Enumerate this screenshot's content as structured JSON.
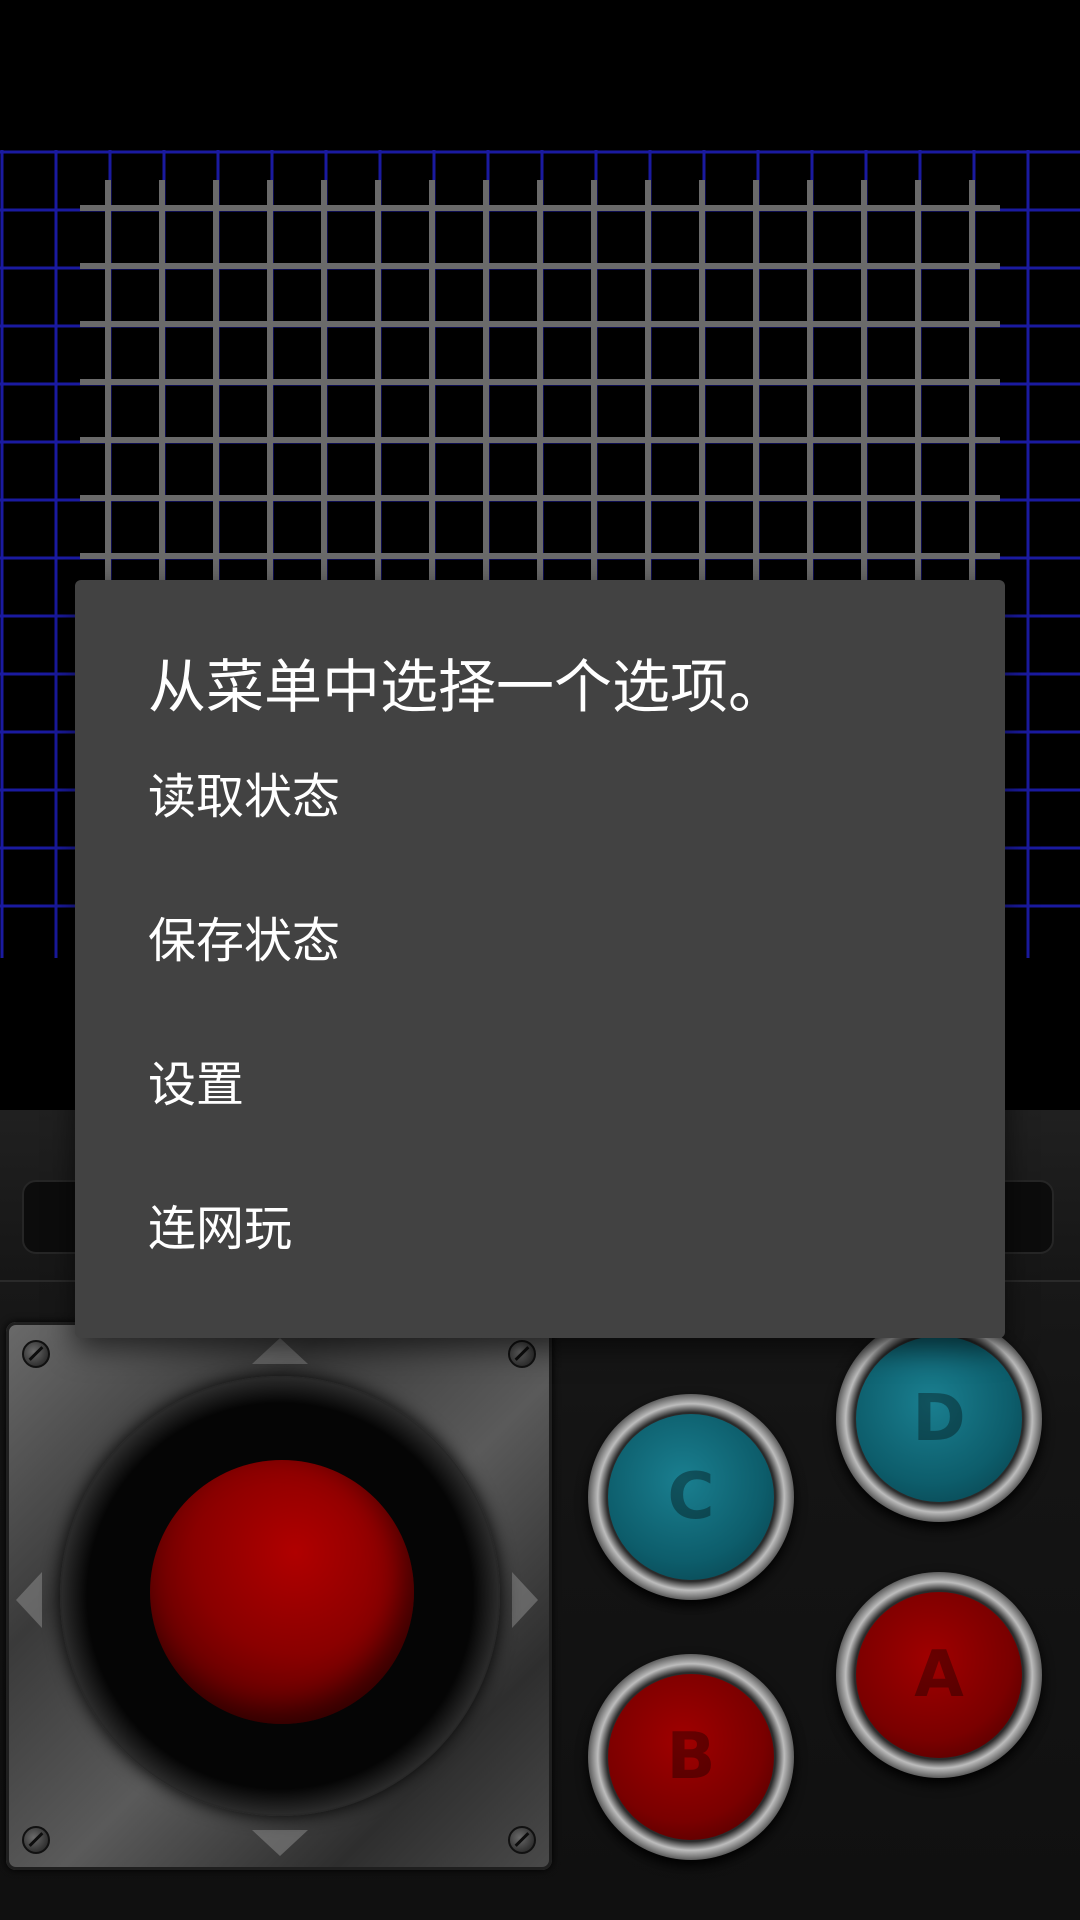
{
  "dialog": {
    "title": "从菜单中选择一个选项。",
    "items": [
      {
        "label": "读取状态"
      },
      {
        "label": "保存状态"
      },
      {
        "label": "设置"
      },
      {
        "label": "连网玩"
      }
    ]
  },
  "controller": {
    "buttons": [
      {
        "id": "a",
        "label": "A",
        "color": "red"
      },
      {
        "id": "b",
        "label": "B",
        "color": "red"
      },
      {
        "id": "c",
        "label": "C",
        "color": "teal"
      },
      {
        "id": "d",
        "label": "D",
        "color": "teal"
      }
    ]
  },
  "colors": {
    "dialog_bg": "#424242",
    "grid_blue": "#1a1aa0",
    "grid_gray": "#6a6a6a",
    "button_teal": "#0d5d6b",
    "button_red": "#7a0000"
  }
}
